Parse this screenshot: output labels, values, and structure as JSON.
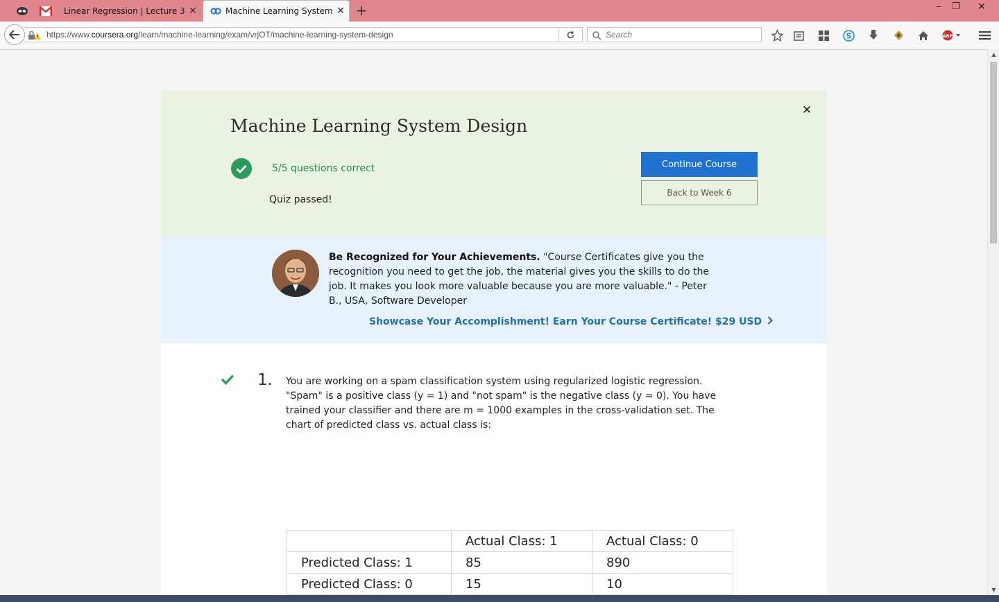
{
  "browser": {
    "tabs": [
      {
        "label": "Linear Regression | Lecture 3: L...",
        "active": false
      },
      {
        "label": "Machine Learning System ...",
        "active": true
      }
    ],
    "url_prefix": "https://www.",
    "url_domain": "coursera.org",
    "url_path": "/learn/machine-learning/exam/vrjOT/machine-learning-system-design",
    "search_placeholder": "Search",
    "toolbar_icons": [
      "star-icon",
      "reading-list-icon",
      "pocket-icon",
      "skype-icon",
      "download-icon",
      "extension-icon",
      "home-icon",
      "adblock-icon",
      "menu-icon"
    ],
    "accent_color": "#e0868c"
  },
  "quiz": {
    "title": "Machine Learning System Design",
    "score": "5/5 questions correct",
    "status": "Quiz passed!",
    "continue_label": "Continue Course",
    "back_label": "Back to Week 6",
    "close_symbol": "✕"
  },
  "promo": {
    "heading": "Be Recognized for Your Achievements.",
    "quote": " \"Course Certificates give you the recognition you need to get the job, the material gives you the skills to do the job. It makes you look more valuable because you are more valuable.\" - Peter B., USA, Software Developer",
    "cta": "Showcase Your Accomplishment! Earn Your Course Certificate! $29 USD"
  },
  "question": {
    "number": "1.",
    "text": "You are working on a spam classification system using regularized logistic regression. \"Spam\" is a positive class (y = 1) and \"not spam\" is the negative class (y = 0). You have trained your classifier and there are m = 1000 examples in the cross-validation set. The chart of predicted class vs. actual class is:",
    "table": {
      "header": [
        "",
        "Actual Class: 1",
        "Actual Class: 0"
      ],
      "rows": [
        [
          "Predicted Class: 1",
          "85",
          "890"
        ],
        [
          "Predicted Class: 0",
          "15",
          "10"
        ]
      ]
    }
  }
}
